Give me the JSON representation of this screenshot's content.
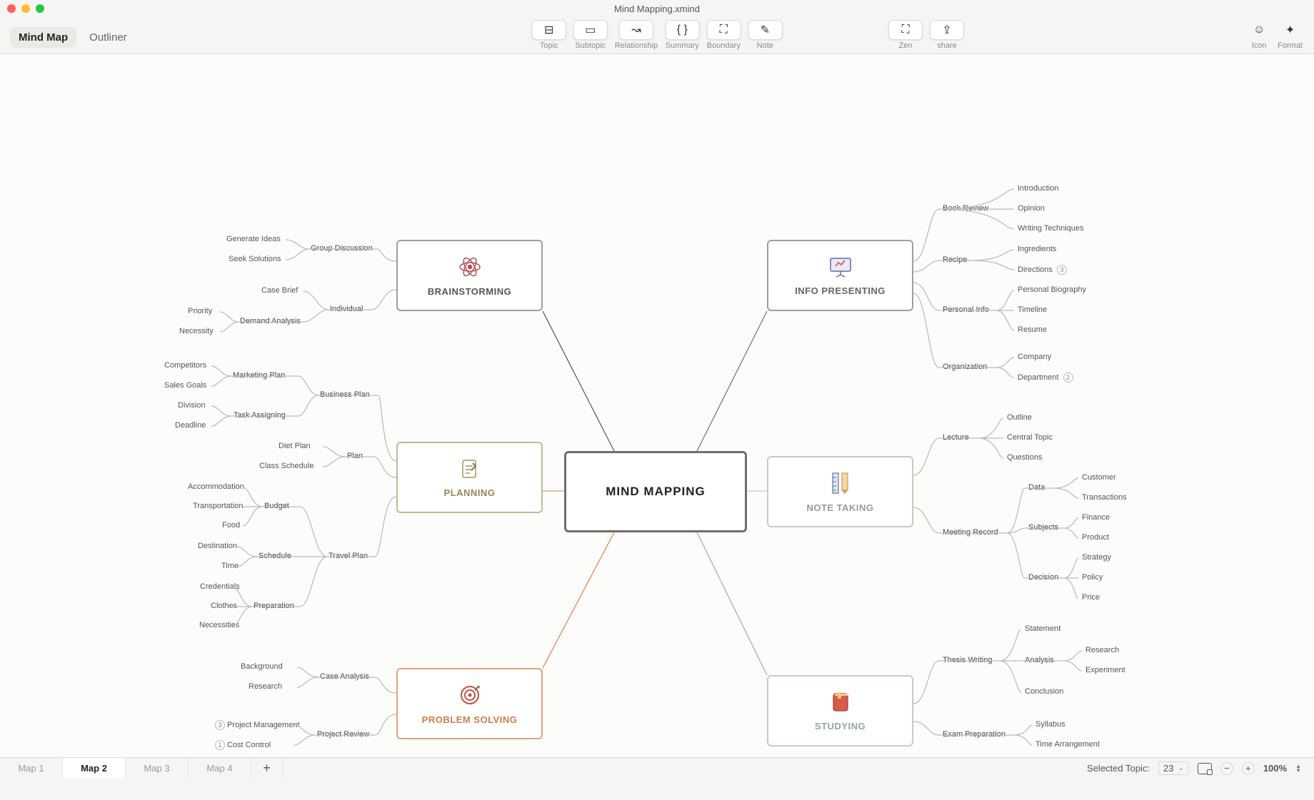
{
  "window": {
    "title": "Mind Mapping.xmind"
  },
  "views": {
    "mind_map": "Mind Map",
    "outliner": "Outliner"
  },
  "toolbar": {
    "topic": "Topic",
    "subtopic": "Subtopic",
    "relationship": "Relationship",
    "summary": "Summary",
    "boundary": "Boundary",
    "note": "Note",
    "zen": "Zen",
    "share": "share",
    "icon": "Icon",
    "format": "Format"
  },
  "tabs": [
    "Map 1",
    "Map 2",
    "Map 3",
    "Map 4"
  ],
  "tabs_active": 1,
  "status": {
    "label": "Selected Topic:",
    "value": "23",
    "zoom": "100%"
  },
  "map": {
    "central": "MIND MAPPING",
    "brainstorming": {
      "title": "BRAINSTORMING",
      "group_discussion": {
        "label": "Group Discussion",
        "leaves": [
          "Generate Ideas",
          "Seek Solutions"
        ]
      },
      "individual": {
        "label": "Individual",
        "case_brief": "Case Brief",
        "demand_analysis": {
          "label": "Demand Analysis",
          "leaves": [
            "Priority",
            "Necessity"
          ]
        }
      }
    },
    "planning": {
      "title": "PLANNING",
      "business_plan": {
        "label": "Business Plan",
        "marketing_plan": {
          "label": "Marketing Plan",
          "leaves": [
            "Competitors",
            "Sales Goals"
          ]
        },
        "task_assigning": {
          "label": "Task Assigning",
          "leaves": [
            "Division",
            "Deadline"
          ]
        }
      },
      "plan": {
        "label": "Plan",
        "leaves": [
          "Diet Plan",
          "Class Schedule"
        ]
      },
      "travel_plan": {
        "label": "Travel Plan",
        "budget": {
          "label": "Budget",
          "leaves": [
            "Accommodation",
            "Transportation",
            "Food"
          ]
        },
        "schedule": {
          "label": "Schedule",
          "leaves": [
            "Destination",
            "Time"
          ]
        },
        "preparation": {
          "label": "Preparation",
          "leaves": [
            "Credentials",
            "Clothes",
            "Necessities"
          ]
        }
      }
    },
    "problem_solving": {
      "title": "PROBLEM SOLVING",
      "case_analysis": {
        "label": "Case Analysis",
        "leaves": [
          "Background",
          "Research"
        ]
      },
      "project_review": {
        "label": "Project Review",
        "project_mgmt": "Project Management",
        "cost": "Cost Control",
        "badge_pm": "3",
        "badge_cc": "1"
      }
    },
    "info_presenting": {
      "title": "INFO PRESENTING",
      "book_review": {
        "label": "Book Review",
        "leaves": [
          "Introduction",
          "Opinion",
          "Writing Techniques"
        ]
      },
      "recipe": {
        "label": "Recipe",
        "ingredients": "Ingredients",
        "directions": "Directions",
        "badge": "3"
      },
      "personal_info": {
        "label": "Personal Info",
        "leaves": [
          "Personal Biography",
          "Timeline",
          "Resume"
        ]
      },
      "organization": {
        "label": "Organization",
        "company": "Company",
        "department": "Department",
        "badge": "2"
      }
    },
    "note_taking": {
      "title": "NOTE TAKING",
      "lecture": {
        "label": "Lecture",
        "leaves": [
          "Outline",
          "Central Topic",
          "Questions"
        ]
      },
      "meeting_record": {
        "label": "Meeting Record",
        "data": {
          "label": "Data",
          "leaves": [
            "Customer",
            "Transactions"
          ]
        },
        "subjects": {
          "label": "Subjects",
          "leaves": [
            "Finance",
            "Product"
          ]
        },
        "decision": {
          "label": "Decision",
          "leaves": [
            "Strategy",
            "Policy",
            "Price"
          ]
        }
      }
    },
    "studying": {
      "title": "STUDYING",
      "thesis": {
        "label": "Thesis Writing",
        "statement": "Statement",
        "analysis": {
          "label": "Analysis",
          "leaves": [
            "Research",
            "Experiment"
          ]
        },
        "conclusion": "Conclusion"
      },
      "exam": {
        "label": "Exam Preparation",
        "leaves": [
          "Syllabus",
          "Time Arrangement"
        ]
      }
    }
  }
}
